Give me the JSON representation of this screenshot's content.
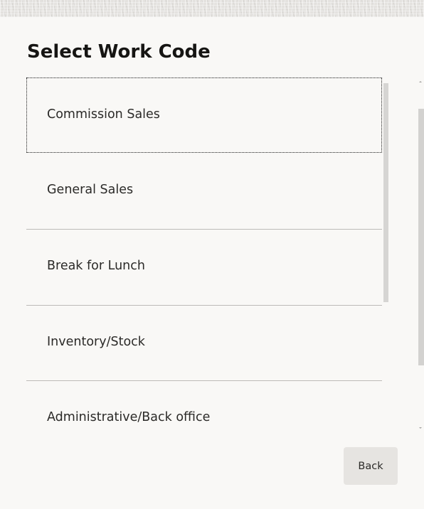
{
  "dialog": {
    "title": "Select Work Code"
  },
  "work_codes": [
    {
      "label": "Commission Sales",
      "focused": true
    },
    {
      "label": "General Sales",
      "focused": false
    },
    {
      "label": "Break for Lunch",
      "focused": false
    },
    {
      "label": "Inventory/Stock",
      "focused": false
    },
    {
      "label": "Administrative/Back office",
      "focused": false
    }
  ],
  "actions": {
    "back_label": "Back"
  },
  "colors": {
    "background": "#f9f8f6",
    "title_text": "#161513",
    "item_text": "#2b2a28",
    "divider": "#bdbbb8",
    "button_bg": "#e6e4e1"
  }
}
